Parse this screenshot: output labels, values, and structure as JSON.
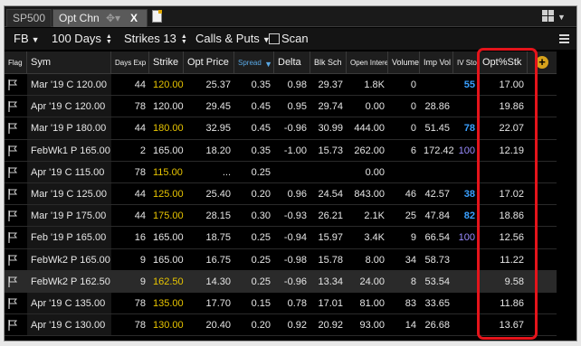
{
  "tabs": [
    {
      "label": "SP500",
      "active": false
    },
    {
      "label": "Opt Chn",
      "active": true,
      "close": "X"
    }
  ],
  "toolbar": {
    "symbol": "FB",
    "days": "100 Days",
    "strikes": "Strikes 13",
    "calls_puts": "Calls & Puts",
    "scan_label": "Scan"
  },
  "columns": {
    "flag": "Flag",
    "sym": "Sym",
    "days_exp": "Days Exp",
    "strike": "Strike",
    "opt_price": "Opt Price",
    "spread": "Spread",
    "delta": "Delta",
    "blk_sch": "Blk Sch",
    "open_interest": "Open Interest",
    "volume": "Volume",
    "imp_vol": "Imp Vol",
    "iv_stock": "IV Stoc",
    "opt_stk": "Opt%Stk"
  },
  "rows": [
    {
      "sym": "Mar '19 C 120.00",
      "days": "44",
      "strike": "120.00",
      "strike_gold": true,
      "opt_price": "25.37",
      "spread": "0.35",
      "delta": "0.98",
      "blk": "29.37",
      "oi": "1.8K",
      "vol": "0",
      "iv": "",
      "ivs": "55",
      "ivs_style": "blue",
      "optstk": "17.00"
    },
    {
      "sym": "Apr '19 C 120.00",
      "days": "78",
      "strike": "120.00",
      "strike_gold": false,
      "opt_price": "29.45",
      "spread": "0.45",
      "delta": "0.95",
      "blk": "29.74",
      "oi": "0.00",
      "vol": "0",
      "iv": "28.86",
      "ivs": "",
      "ivs_style": "",
      "optstk": "19.86"
    },
    {
      "sym": "Mar '19 P 180.00",
      "days": "44",
      "strike": "180.00",
      "strike_gold": true,
      "opt_price": "32.95",
      "spread": "0.45",
      "delta": "-0.96",
      "blk": "30.99",
      "oi": "444.00",
      "vol": "0",
      "iv": "51.45",
      "ivs": "78",
      "ivs_style": "blue",
      "optstk": "22.07"
    },
    {
      "sym": "FebWk1 P 165.00",
      "days": "2",
      "strike": "165.00",
      "strike_gold": false,
      "opt_price": "18.20",
      "spread": "0.35",
      "delta": "-1.00",
      "blk": "15.73",
      "oi": "262.00",
      "vol": "6",
      "iv": "172.42",
      "ivs": "100",
      "ivs_style": "blue2",
      "optstk": "12.19"
    },
    {
      "sym": "Apr '19 C 115.00",
      "days": "78",
      "strike": "115.00",
      "strike_gold": true,
      "opt_price": "...",
      "spread": "0.25",
      "delta": "",
      "blk": "",
      "oi": "0.00",
      "vol": "",
      "iv": "",
      "ivs": "",
      "ivs_style": "",
      "optstk": ""
    },
    {
      "sym": "Mar '19 C 125.00",
      "days": "44",
      "strike": "125.00",
      "strike_gold": true,
      "opt_price": "25.40",
      "spread": "0.20",
      "delta": "0.96",
      "blk": "24.54",
      "oi": "843.00",
      "vol": "46",
      "iv": "42.57",
      "ivs": "38",
      "ivs_style": "blue",
      "optstk": "17.02"
    },
    {
      "sym": "Mar '19 P 175.00",
      "days": "44",
      "strike": "175.00",
      "strike_gold": true,
      "opt_price": "28.15",
      "spread": "0.30",
      "delta": "-0.93",
      "blk": "26.21",
      "oi": "2.1K",
      "vol": "25",
      "iv": "47.84",
      "ivs": "82",
      "ivs_style": "blue",
      "optstk": "18.86"
    },
    {
      "sym": "Feb '19 P 165.00",
      "days": "16",
      "strike": "165.00",
      "strike_gold": false,
      "opt_price": "18.75",
      "spread": "0.25",
      "delta": "-0.94",
      "blk": "15.97",
      "oi": "3.4K",
      "vol": "9",
      "iv": "66.54",
      "ivs": "100",
      "ivs_style": "blue2",
      "optstk": "12.56"
    },
    {
      "sym": "FebWk2 P 165.00",
      "days": "9",
      "strike": "165.00",
      "strike_gold": false,
      "opt_price": "16.75",
      "spread": "0.25",
      "delta": "-0.98",
      "blk": "15.78",
      "oi": "8.00",
      "vol": "34",
      "iv": "58.73",
      "ivs": "",
      "ivs_style": "",
      "optstk": "11.22"
    },
    {
      "sym": "FebWk2 P 162.50",
      "days": "9",
      "strike": "162.50",
      "strike_gold": true,
      "opt_price": "14.30",
      "spread": "0.25",
      "delta": "-0.96",
      "blk": "13.34",
      "oi": "24.00",
      "vol": "8",
      "iv": "53.54",
      "ivs": "",
      "ivs_style": "",
      "optstk": "9.58"
    },
    {
      "sym": "Apr '19 C 135.00",
      "days": "78",
      "strike": "135.00",
      "strike_gold": true,
      "opt_price": "17.70",
      "spread": "0.15",
      "delta": "0.78",
      "blk": "17.01",
      "oi": "81.00",
      "vol": "83",
      "iv": "33.65",
      "ivs": "",
      "ivs_style": "",
      "optstk": "11.86"
    },
    {
      "sym": "Apr '19 C 130.00",
      "days": "78",
      "strike": "130.00",
      "strike_gold": true,
      "opt_price": "20.40",
      "spread": "0.20",
      "delta": "0.92",
      "blk": "20.92",
      "oi": "93.00",
      "vol": "14",
      "iv": "26.68",
      "ivs": "",
      "ivs_style": "",
      "optstk": "13.67"
    }
  ]
}
